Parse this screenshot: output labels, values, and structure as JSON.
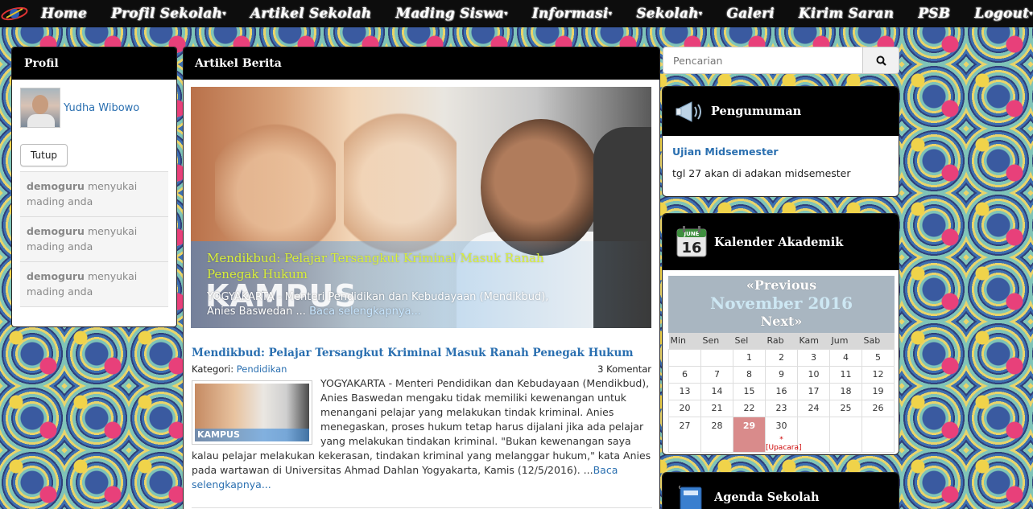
{
  "nav": {
    "items": [
      {
        "label": "Home",
        "dropdown": false
      },
      {
        "label": "Profil Sekolah",
        "dropdown": true
      },
      {
        "label": "Artikel Sekolah",
        "dropdown": false
      },
      {
        "label": "Mading Siswa",
        "dropdown": true
      },
      {
        "label": "Informasi",
        "dropdown": true
      },
      {
        "label": "Sekolah",
        "dropdown": true
      },
      {
        "label": "Galeri",
        "dropdown": false
      },
      {
        "label": "Kirim Saran",
        "dropdown": false
      },
      {
        "label": "PSB",
        "dropdown": false
      },
      {
        "label": "Logout",
        "dropdown": true
      }
    ]
  },
  "profil": {
    "title": "Profil",
    "user_name": "Yudha Wibowo",
    "close_label": "Tutup",
    "notifications": [
      {
        "user": "demoguru",
        "text": "menyukai mading anda"
      },
      {
        "user": "demoguru",
        "text": "menyukai mading anda"
      },
      {
        "user": "demoguru",
        "text": "menyukai mading anda"
      }
    ]
  },
  "artikel": {
    "title": "Artikel Berita",
    "hero": {
      "title": "Mendikbud: Pelajar Tersangkut Kriminal Masuk Ranah Penegak Hukum",
      "brand": "KAMPUS",
      "snippet": "YOGYAKARTA - Menteri Pendidikan dan Kebudayaan (Mendikbud), Anies Baswedan ...",
      "link": "Baca selengkapnya..."
    },
    "post": {
      "title": "Mendikbud: Pelajar Tersangkut Kriminal Masuk Ranah Penegak Hukum",
      "category_label": "Kategori:",
      "category": "Pendidikan",
      "comments": "3 Komentar",
      "thumb_label": "KAMPUS",
      "body": "YOGYAKARTA - Menteri Pendidikan dan Kebudayaan (Mendikbud), Anies Baswedan mengaku tidak memiliki kewenangan untuk menangani pelajar yang melakukan tindak kriminal. Anies menegaskan, proses hukum tetap harus dijalani jika ada pelajar yang melakukan tindakan kriminal. \"Bukan kewenangan saya kalau pelajar melakukan kekerasan, tindakan kriminal yang melanggar hukum,\" kata Anies pada wartawan di Universitas Ahmad Dahlan Yogyakarta, Kamis (12/5/2016). ...",
      "read_more": "Baca selengkapnya..."
    }
  },
  "search": {
    "placeholder": "Pencarian"
  },
  "pengumuman": {
    "title": "Pengumuman",
    "item_title": "Ujian Midsemester",
    "item_body": "tgl 27 akan di adakan midsemester"
  },
  "kalender": {
    "title": "Kalender Akademik",
    "icon_month": "JUNE",
    "icon_day": "16",
    "prev": "«Previous",
    "month": "November 2016",
    "next": "Next»",
    "days": [
      "Min",
      "Sen",
      "Sel",
      "Rab",
      "Kam",
      "Jum",
      "Sab"
    ],
    "weeks": [
      [
        "",
        "",
        "1",
        "2",
        "3",
        "4",
        "5"
      ],
      [
        "6",
        "7",
        "8",
        "9",
        "10",
        "11",
        "12"
      ],
      [
        "13",
        "14",
        "15",
        "16",
        "17",
        "18",
        "19"
      ],
      [
        "20",
        "21",
        "22",
        "23",
        "24",
        "25",
        "26"
      ],
      [
        "27",
        "28",
        "29",
        "30",
        "",
        "",
        ""
      ]
    ],
    "today": "29",
    "event_day": "30",
    "event_label": "*[Upacara]"
  },
  "agenda": {
    "title": "Agenda Sekolah"
  },
  "colors": {
    "link": "#2a6fb0",
    "today": "#d98b8b",
    "hero_title": "#d9ef3a"
  }
}
